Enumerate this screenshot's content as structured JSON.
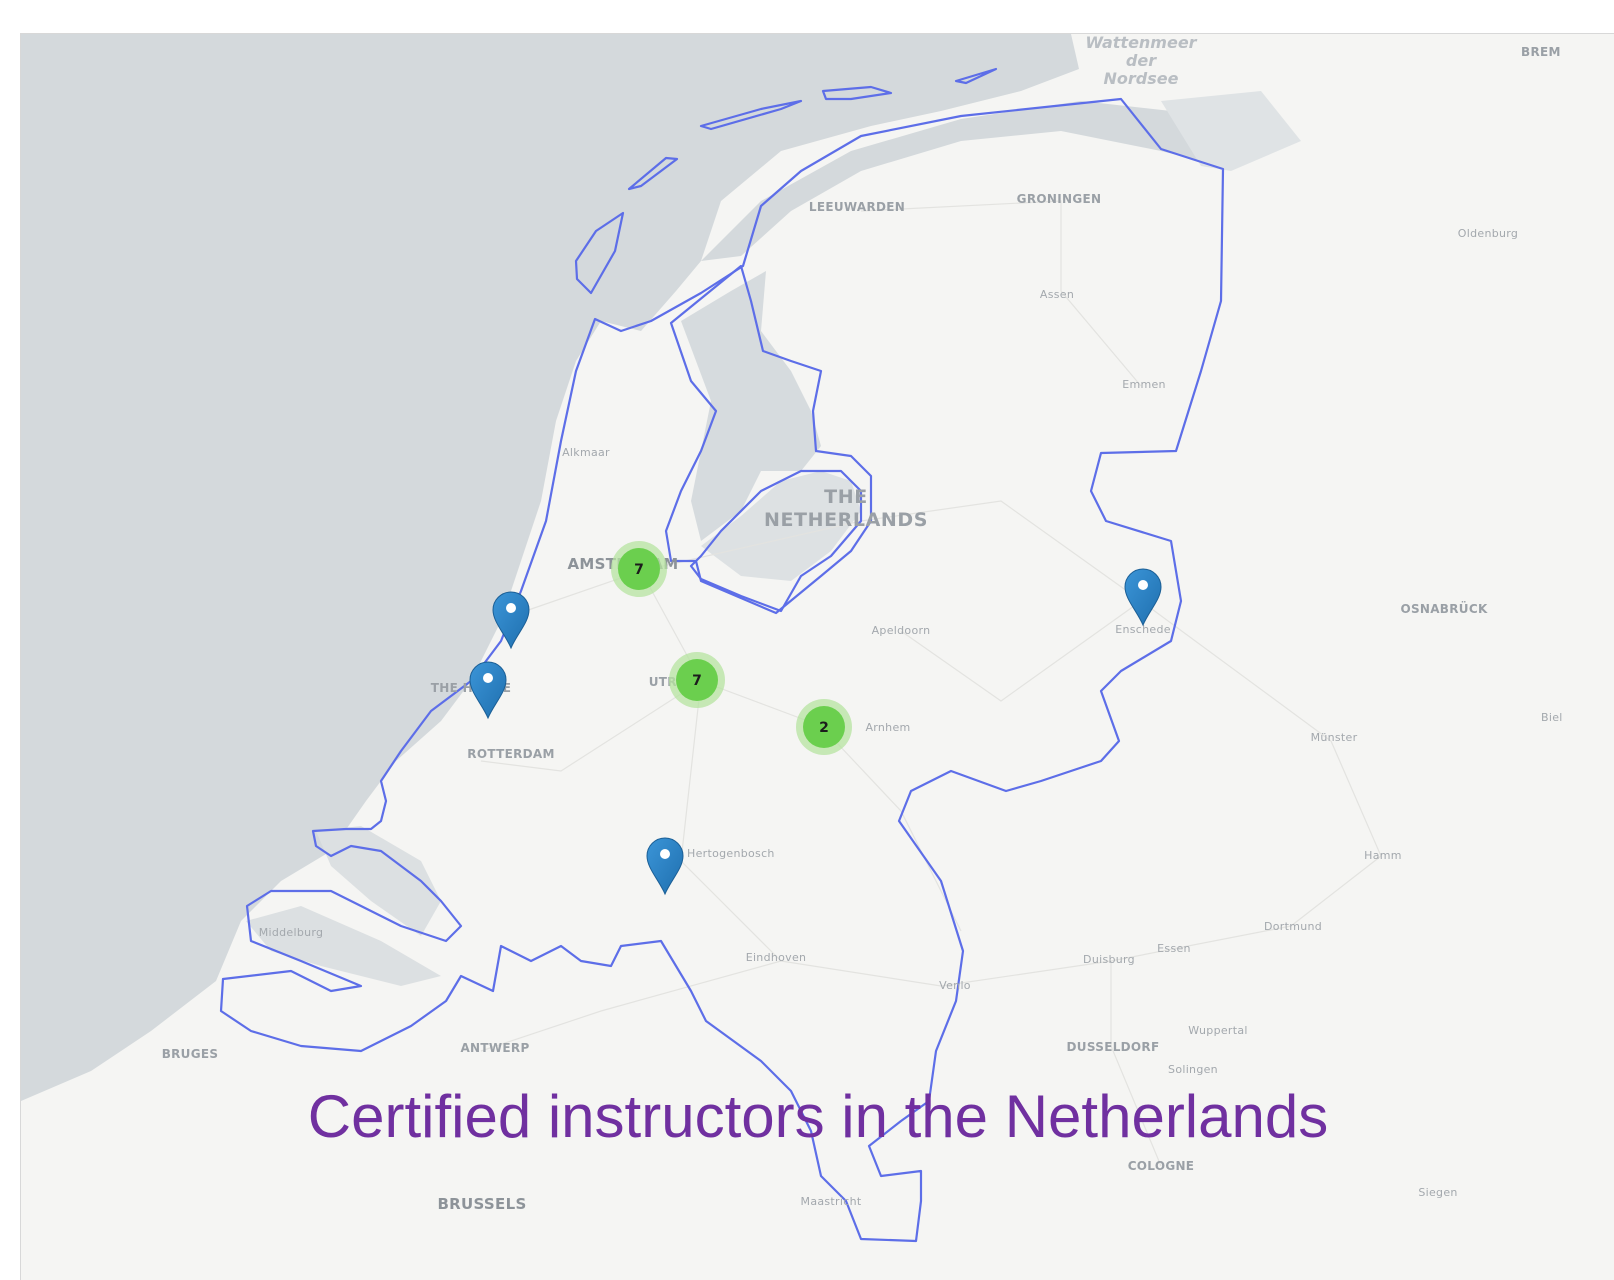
{
  "caption": "Certified instructors in the Netherlands",
  "colors": {
    "land": "#f5f5f3",
    "sea": "#d4d9dc",
    "lake": "#d6dbde",
    "boundary": "#5d6ee8",
    "cluster_fill": "#6bcf4e",
    "cluster_halo": "#b6e3a0",
    "marker": "#2c82c9",
    "caption": "#7030a0"
  },
  "labels": {
    "wattenmeer_1": "Wattenmeer",
    "wattenmeer_2": "der",
    "wattenmeer_3": "Nordsee",
    "country_1": "THE",
    "country_2": "NETHERLANDS",
    "bremen": "BREM",
    "leeuwarden": "LEEUWARDEN",
    "groningen": "GRONINGEN",
    "oldenburg": "Oldenburg",
    "assen": "Assen",
    "emmen": "Emmen",
    "alkmaar": "Alkmaar",
    "amsterdam": "AMSTERDAM",
    "apeldoorn": "Apeldoorn",
    "enschede": "Enschede",
    "osnabruck": "OSNABRÜCK",
    "the_hague": "THE HAGUE",
    "utrecht": "UTRECHT",
    "arnhem": "Arnhem",
    "rotterdam": "ROTTERDAM",
    "munster": "Münster",
    "bielefeld": "Biel",
    "hertogenbosch": "Hertogenbosch",
    "hamm": "Hamm",
    "middelburg": "Middelburg",
    "dortmund": "Dortmund",
    "eindhoven": "Eindhoven",
    "essen": "Essen",
    "duisburg": "Duisburg",
    "venlo": "Venlo",
    "wuppertal": "Wuppertal",
    "bruges": "BRUGES",
    "antwerp": "ANTWERP",
    "dusseldorf": "DUSSELDORF",
    "solingen": "Solingen",
    "cologne": "COLOGNE",
    "siegen": "Siegen",
    "brussels": "BRUSSELS",
    "maastricht": "Maastricht"
  },
  "clusters": [
    {
      "name": "amsterdam",
      "count": "7"
    },
    {
      "name": "utrecht",
      "count": "7"
    },
    {
      "name": "arnhem",
      "count": "2"
    }
  ],
  "markers": [
    {
      "name": "haarlem-area",
      "label": ""
    },
    {
      "name": "the-hague",
      "label": ""
    },
    {
      "name": "enschede",
      "label": ""
    },
    {
      "name": "hertogenbosch",
      "label": ""
    }
  ]
}
